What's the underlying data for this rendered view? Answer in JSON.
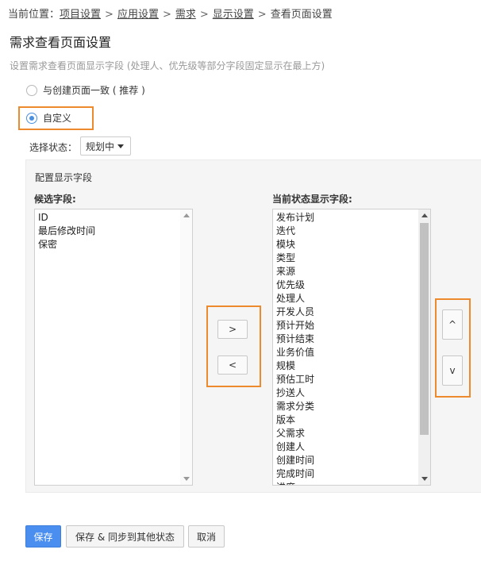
{
  "breadcrumb": {
    "prefix": "当前位置：",
    "items": [
      "项目设置",
      "应用设置",
      "需求",
      "显示设置",
      "查看页面设置"
    ],
    "separator": ">"
  },
  "page": {
    "title": "需求查看页面设置",
    "description": "设置需求查看页面显示字段 (处理人、优先级等部分字段固定显示在最上方)"
  },
  "options": {
    "same_as_create": "与创建页面一致 ( 推荐 )",
    "custom": "自定义",
    "selected": "custom"
  },
  "status_filter": {
    "label": "选择状态：",
    "value": "规划中"
  },
  "config": {
    "title": "配置显示字段",
    "candidate_label": "候选字段:",
    "current_label": "当前状态显示字段:",
    "candidate_fields": [
      "ID",
      "最后修改时间",
      "保密"
    ],
    "current_fields": [
      "发布计划",
      "迭代",
      "模块",
      "类型",
      "来源",
      "优先级",
      "处理人",
      "开发人员",
      "预计开始",
      "预计结束",
      "业务价值",
      "规模",
      "预估工时",
      "抄送人",
      "需求分类",
      "版本",
      "父需求",
      "创建人",
      "创建时间",
      "完成时间",
      "进度"
    ]
  },
  "buttons": {
    "add": ">",
    "remove": "<",
    "move_up": "^",
    "move_down": "v",
    "save": "保存",
    "save_sync": "保存 & 同步到其他状态",
    "cancel": "取消"
  },
  "colors": {
    "accent": "#4a8ff0",
    "highlight": "#ee8a2e"
  }
}
